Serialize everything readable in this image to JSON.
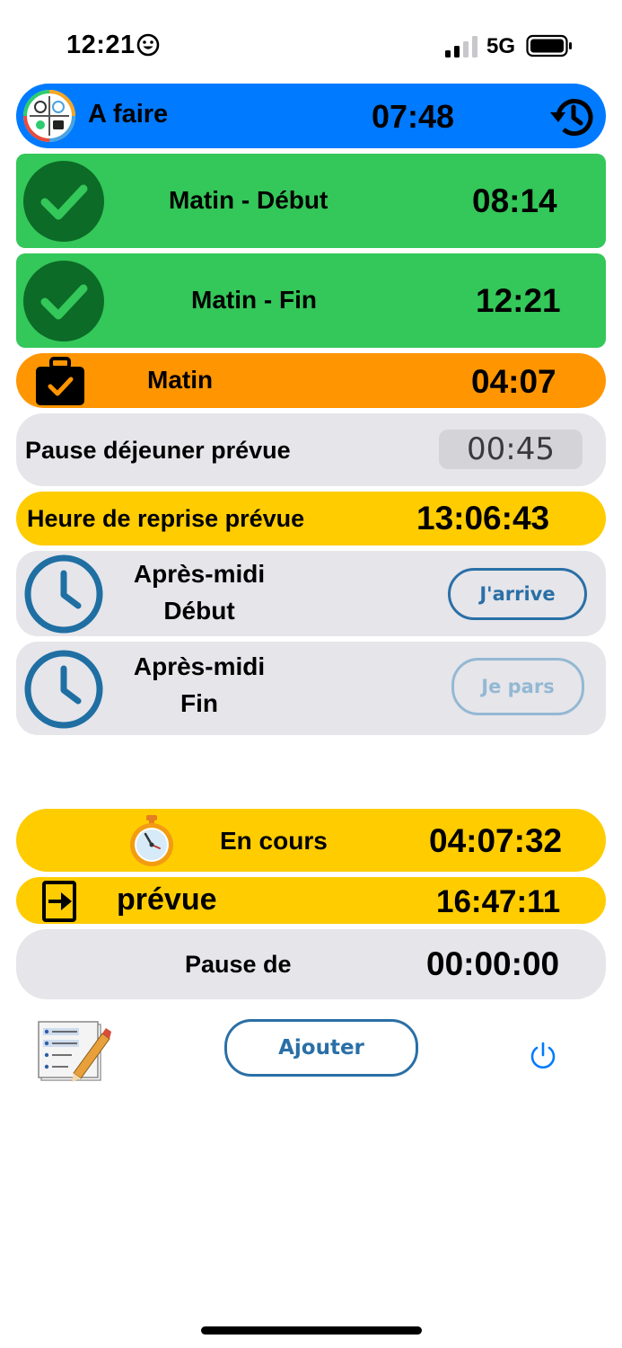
{
  "status": {
    "time": "12:21",
    "network": "5G"
  },
  "header": {
    "title": "A faire",
    "time": "07:48",
    "color": "#007aff"
  },
  "morning_start": {
    "label": "Matin - Début",
    "time": "08:14",
    "color": "#34c759"
  },
  "morning_end": {
    "label": "Matin - Fin",
    "time": "12:21"
  },
  "morning_total": {
    "label": "Matin",
    "time": "04:07",
    "color": "#ff9500"
  },
  "lunch": {
    "label": "Pause déjeuner prévue",
    "value": "00:45"
  },
  "resume": {
    "label": "Heure de reprise prévue",
    "time": "13:06:43",
    "color": "#ffcc00"
  },
  "afternoon_start": {
    "line1": "Après-midi",
    "line2": "Début",
    "button": "J'arrive"
  },
  "afternoon_end": {
    "line1": "Après-midi",
    "line2": "Fin",
    "button": "Je pars"
  },
  "in_progress": {
    "label": "En cours",
    "time": "04:07:32"
  },
  "planned_exit": {
    "label": "prévue",
    "time": "16:47:11"
  },
  "pause": {
    "label": "Pause de",
    "time": "00:00:00"
  },
  "footer": {
    "add_button": "Ajouter"
  }
}
